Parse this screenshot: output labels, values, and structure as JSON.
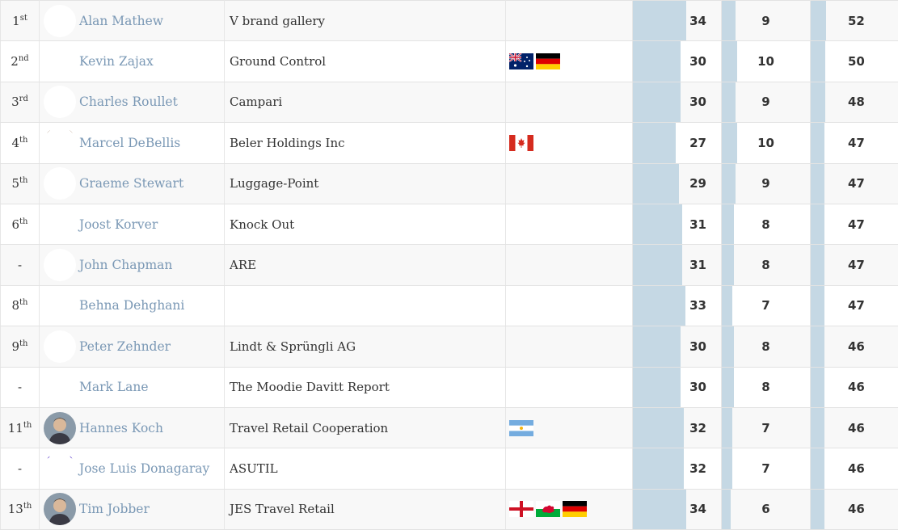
{
  "rows": [
    {
      "rank_num": "1",
      "rank_suffix": "st",
      "name": "Alan Mathew",
      "company": "V brand gallery",
      "flags": [],
      "v1": 34,
      "v2": 9,
      "v3": 52,
      "avatar_color": "#b84fd6"
    },
    {
      "rank_num": "2",
      "rank_suffix": "nd",
      "name": "Kevin Zajax",
      "company": "Ground Control",
      "flags": [
        "australia",
        "germany"
      ],
      "v1": 30,
      "v2": 10,
      "v3": 50,
      "avatar_color": "#5a3c8c"
    },
    {
      "rank_num": "3",
      "rank_suffix": "rd",
      "name": "Charles Roullet",
      "company": "Campari",
      "flags": [],
      "v1": 30,
      "v2": 9,
      "v3": 48,
      "avatar_color": "#a8a88a"
    },
    {
      "rank_num": "4",
      "rank_suffix": "th",
      "name": "Marcel DeBellis",
      "company": "Beler Holdings Inc",
      "flags": [
        "canada"
      ],
      "v1": 27,
      "v2": 10,
      "v3": 47,
      "avatar_color": "#7a4a25"
    },
    {
      "rank_num": "5",
      "rank_suffix": "th",
      "name": "Graeme Stewart",
      "company": "Luggage-Point",
      "flags": [],
      "v1": 29,
      "v2": 9,
      "v3": 47,
      "avatar_color": "#9cc7e4"
    },
    {
      "rank_num": "6",
      "rank_suffix": "th",
      "name": "Joost Korver",
      "company": "Knock Out",
      "flags": [],
      "v1": 31,
      "v2": 8,
      "v3": 47,
      "avatar_color": "#8ce86a"
    },
    {
      "rank_num": "-",
      "rank_suffix": "",
      "name": "John Chapman",
      "company": "ARE",
      "flags": [],
      "v1": 31,
      "v2": 8,
      "v3": 47,
      "avatar_color": "#8a5ccc"
    },
    {
      "rank_num": "8",
      "rank_suffix": "th",
      "name": "Behna Dehghani",
      "company": "",
      "flags": [],
      "v1": 33,
      "v2": 7,
      "v3": 47,
      "avatar_color": "#2d5e4a"
    },
    {
      "rank_num": "9",
      "rank_suffix": "th",
      "name": "Peter Zehnder",
      "company": "Lindt & Sprüngli AG",
      "flags": [],
      "v1": 30,
      "v2": 8,
      "v3": 46,
      "avatar_color": "#6cd4a8"
    },
    {
      "rank_num": "-",
      "rank_suffix": "",
      "name": "Mark Lane",
      "company": "The Moodie Davitt Report",
      "flags": [],
      "v1": 30,
      "v2": 8,
      "v3": 46,
      "avatar_color": "#b456d8"
    },
    {
      "rank_num": "11",
      "rank_suffix": "th",
      "name": "Hannes Koch",
      "company": "Travel Retail Cooperation",
      "flags": [
        "argentina"
      ],
      "v1": 32,
      "v2": 7,
      "v3": 46,
      "avatar_color": "photo"
    },
    {
      "rank_num": "-",
      "rank_suffix": "",
      "name": "Jose Luis Donagaray",
      "company": "ASUTIL",
      "flags": [],
      "v1": 32,
      "v2": 7,
      "v3": 46,
      "avatar_color": "#6a4ed0"
    },
    {
      "rank_num": "13",
      "rank_suffix": "th",
      "name": "Tim Jobber",
      "company": "JES Travel Retail",
      "flags": [
        "england",
        "wales",
        "germany"
      ],
      "v1": 34,
      "v2": 6,
      "v3": 46,
      "avatar_color": "photo"
    }
  ]
}
